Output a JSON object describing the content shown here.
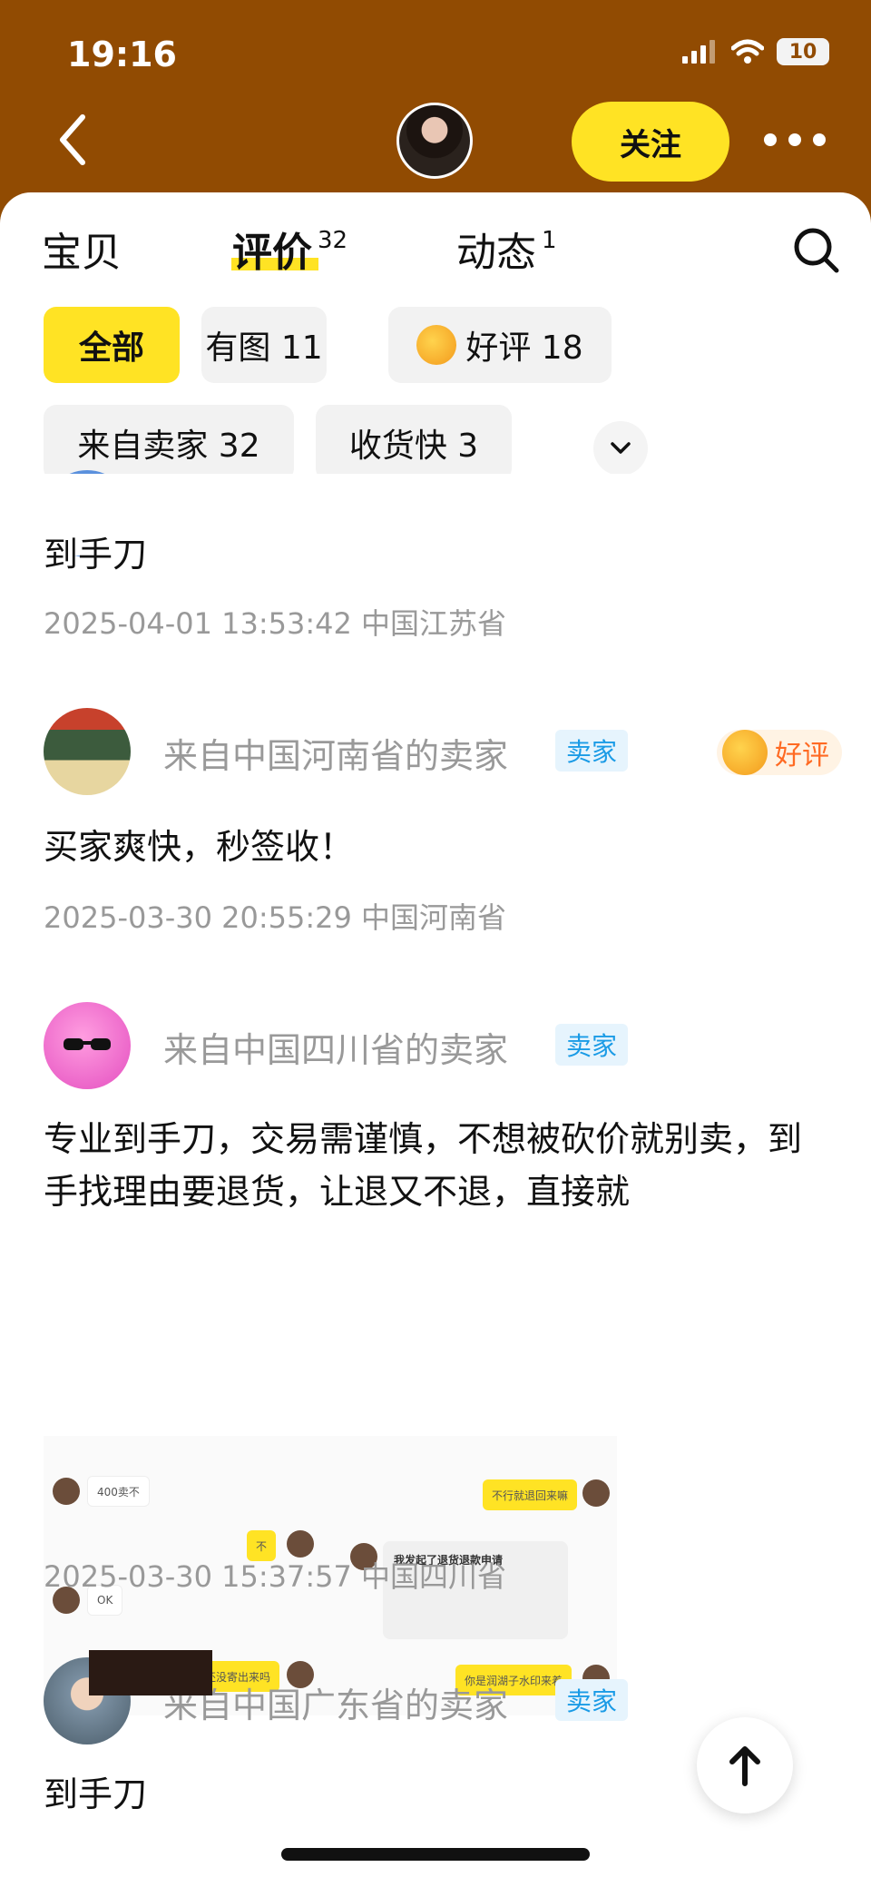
{
  "status": {
    "time": "19:16",
    "battery": "10"
  },
  "header": {
    "follow_label": "关注"
  },
  "tabs": [
    {
      "label": "宝贝",
      "count": ""
    },
    {
      "label": "评价",
      "count": "32"
    },
    {
      "label": "动态",
      "count": "1"
    }
  ],
  "filters": {
    "all": "全部",
    "with_image": "有图 11",
    "good": "好评 18",
    "from_seller": "来自卖家 32",
    "fast_delivery": "收货快 3"
  },
  "reviews": [
    {
      "text": "到手刀",
      "meta": "2025-04-01 13:53:42 中国江苏省"
    },
    {
      "name": "来自中国河南省的卖家",
      "badge": "卖家",
      "rating": "好评",
      "text": "买家爽快，秒签收！",
      "meta": "2025-03-30 20:55:29 中国河南省"
    },
    {
      "name": "来自中国四川省的卖家",
      "badge": "卖家",
      "text": "专业到手刀，交易需谨慎，不想被砍价就别卖，到手找理由要退货，让退又不退，直接就",
      "meta": "2025-03-30 15:37:57 中国四川省",
      "chat": {
        "b1": "400卖不",
        "b2": "不行就退回来嘛",
        "b3": "不",
        "b4": "我发起了退货退款申请",
        "b5": "OK",
        "b6": "还没寄出来吗",
        "b7": "你是润湖子水印来着"
      }
    },
    {
      "name": "来自中国广东省的卖家",
      "badge": "卖家",
      "text": "到手刀"
    }
  ],
  "colors": {
    "brand": "#914b02",
    "accent": "#ffe324",
    "badge": "#1a9be6",
    "good": "#ff6a22"
  }
}
